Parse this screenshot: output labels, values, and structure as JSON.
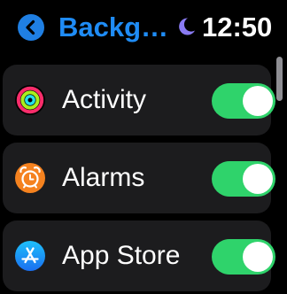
{
  "header": {
    "back_title": "Backg…",
    "time": "12:50",
    "icons": {
      "back": "chevron-left-icon",
      "focus": "moon-icon"
    }
  },
  "settings": [
    {
      "label": "Activity",
      "icon": "activity-rings-icon",
      "enabled": true
    },
    {
      "label": "Alarms",
      "icon": "alarm-clock-icon",
      "enabled": true
    },
    {
      "label": "App Store",
      "icon": "app-store-icon",
      "enabled": true
    }
  ],
  "colors": {
    "accent": "#1f8cf5",
    "toggle_on": "#2fd36b",
    "row_background": "#1c1c1e",
    "moon": "#8a7bf2"
  }
}
